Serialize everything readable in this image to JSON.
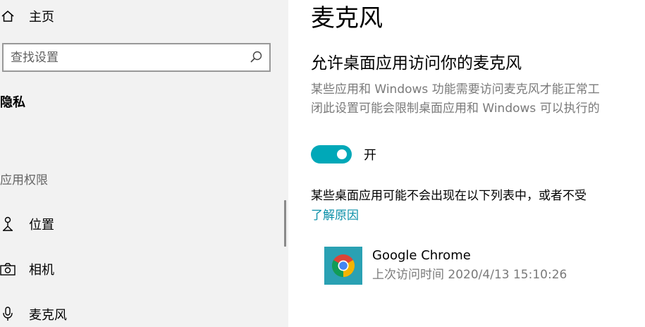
{
  "sidebar": {
    "home_label": "主页",
    "search_placeholder": "查找设置",
    "section_title": "隐私",
    "group_title": "应用权限",
    "items": [
      {
        "label": "位置",
        "icon": "location-person-icon"
      },
      {
        "label": "相机",
        "icon": "camera-icon"
      },
      {
        "label": "麦克风",
        "icon": "microphone-icon"
      }
    ]
  },
  "main": {
    "title": "麦克风",
    "subtitle": "允许桌面应用访问你的麦克风",
    "description_line1": "某些应用和 Windows 功能需要访问麦克风才能正常工",
    "description_line2": "闭此设置可能会限制桌面应用和 Windows 可以执行的",
    "toggle_state_label": "开",
    "toggle_on": true,
    "note": "某些桌面应用可能不会出现在以下列表中，或者不受",
    "learn_more_link": "了解原因",
    "apps": [
      {
        "name": "Google Chrome",
        "last_access": "上次访问时间 2020/4/13 15:10:26",
        "icon": "chrome-icon"
      }
    ]
  },
  "colors": {
    "accent": "#00a8b8",
    "link": "#0a8fa8",
    "app_tile": "#2aa1b3",
    "sidebar_bg": "#f2f2f2"
  }
}
